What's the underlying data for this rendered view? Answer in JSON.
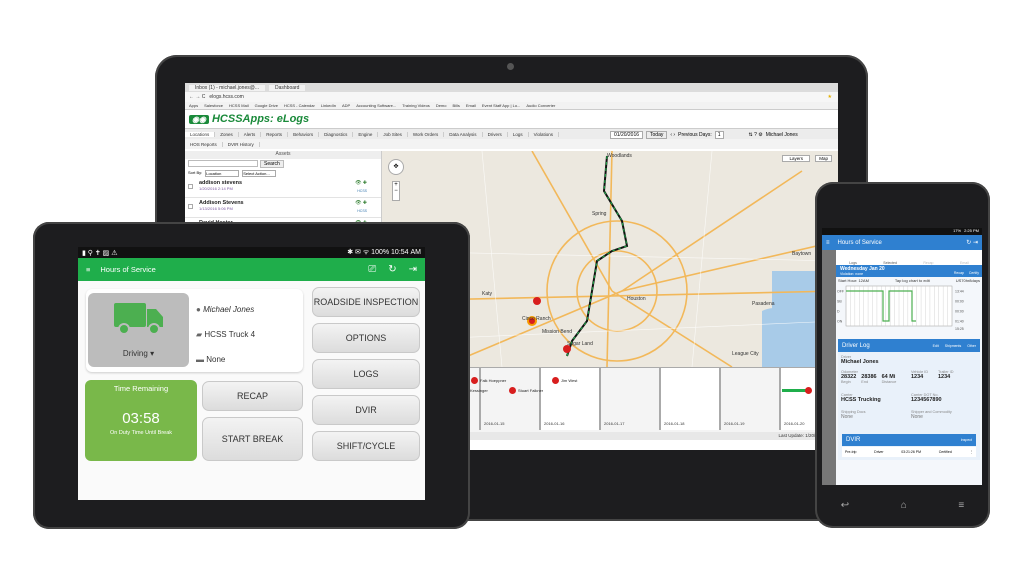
{
  "browser": {
    "tabs": [
      "Inbox (1) - michael.jones@...",
      "Dashboard"
    ],
    "url": "elogs.hcss.com",
    "bookmarks": [
      "Apps",
      "Salesforce",
      "HCSS Mail",
      "Google Drive",
      "HCSS - Calendar",
      "LinkedIn",
      "ADP",
      "Accounting Software...",
      "Training Videos",
      "Demo",
      "Bills",
      "Email",
      "Event Staff App | Lo...",
      "Audio Converter"
    ]
  },
  "elogs": {
    "logo": "HCSSApps: eLogs",
    "nav": [
      "Locations",
      "Zones",
      "Alerts",
      "Reports",
      "Behaviors",
      "Diagnostics",
      "Engine",
      "Job Sites",
      "Work Orders",
      "Data Analysis",
      "Drivers",
      "Logs",
      "Violations"
    ],
    "nav2": [
      "HOS Reports",
      "DVIR History"
    ],
    "date": "01/20/2016",
    "today": "Today",
    "previous_days_label": "Previous Days:",
    "previous_days": "1",
    "user": "Michael Jones",
    "assets": {
      "title": "Assets",
      "search": "Search",
      "sort_by": "Sort By:",
      "sort_value": "Location",
      "action": "Select Action...",
      "items": [
        {
          "name": "addison stevens",
          "time": "1/20/2016 2:14 PM",
          "tag": "HCSS"
        },
        {
          "name": "Addison Stevens",
          "time": "1/13/2016 5:06 PM",
          "tag": "HCSS"
        },
        {
          "name": "David Hester",
          "time": "",
          "tag": ""
        }
      ]
    },
    "map": {
      "layers": "Layers",
      "map_btn": "Map",
      "places": [
        "Woodlands",
        "Houston",
        "Pasadena",
        "Sugar Land",
        "Katy",
        "Cinco Ranch",
        "Mission Bend",
        "Conroe",
        "Baytown",
        "League City",
        "Spring"
      ]
    },
    "timeline": {
      "dates": [
        "2016-01-15",
        "2016-01-16",
        "2016-01-17",
        "2016-01-18",
        "2016-01-19",
        "2016-01-20"
      ],
      "events": [
        "Kessinger",
        "Falk Hoeppner",
        "Stuart Falkner",
        "Jim West"
      ],
      "last_update": "Last Update: 1/20/2016, 2:1"
    }
  },
  "android": {
    "status_time": "10:54 AM",
    "battery": "100%",
    "title": "Hours of Service",
    "status": "Driving",
    "driver": "Michael Jones",
    "truck": "HCSS Truck 4",
    "trailer": "None",
    "time_remaining_label": "Time Remaining",
    "time_remaining": "03:58",
    "time_remaining_sub": "On Duty Time Until Break",
    "buttons": [
      "ROADSIDE INSPECTION",
      "OPTIONS",
      "LOGS",
      "DVIR",
      "SHIFT/CYCLE"
    ],
    "recap": "RECAP",
    "start_break": "START BREAK",
    "accent": "#1fae4b"
  },
  "phone": {
    "status_time": "2:25 PM",
    "battery": "17%",
    "title": "Hours of Service",
    "tools": [
      "Logs",
      "Selected",
      "Recap",
      "Email"
    ],
    "day": "Wednesday Jan 20",
    "violation": "Violation: none",
    "day_actions": [
      "Recap",
      "Certify"
    ],
    "start_hour": "Start Hour: 12AM",
    "tap_hint": "Tap log chart to edit",
    "cycle": "US70hr8days",
    "chart_rows": [
      "OFF",
      "SB",
      "D",
      "ON"
    ],
    "totals": [
      "13:44",
      "00:00",
      "00:00",
      "01:40"
    ],
    "grand_total": "15:25",
    "driver_log": {
      "title": "Driver Log",
      "actions": [
        "Edit",
        "Shipments",
        "Other"
      ],
      "driver_label": "Driver",
      "driver": "Michael Jones",
      "odometer_label": "Odometer",
      "begin": "28322",
      "end": "28386",
      "distance": "64 Mi",
      "begin_l": "Begin",
      "end_l": "End",
      "distance_l": "Distance",
      "vehicle_label": "Vehicle ID",
      "vehicle": "1234",
      "trailer_label": "Trailer ID",
      "trailer": "1234",
      "carrier_label": "Carrier",
      "carrier": "HCSS Trucking",
      "dot_label": "Carrier DOT No.",
      "dot": "1234567890",
      "ship_label": "Shipping Docs",
      "ship": "None",
      "shipper_label": "Shipper and Commodity",
      "shipper": "None"
    },
    "dvir": {
      "title": "DVIR",
      "action": "Inspect",
      "row": [
        "Pre-trip",
        "Driver",
        "03:21:26 PM",
        "Certified"
      ]
    },
    "accent": "#2f80d0"
  }
}
